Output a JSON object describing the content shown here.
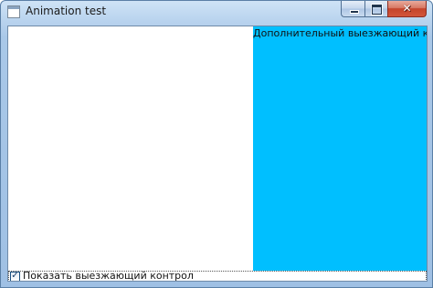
{
  "window": {
    "title": "Animation test"
  },
  "caption_buttons": {
    "minimize_icon": "minimize-icon",
    "maximize_icon": "maximize-icon",
    "close_icon": "close-icon",
    "close_glyph": "✕"
  },
  "slide_panel": {
    "text": "Дополнительный выезжающий контен",
    "background_color": "#00bfff"
  },
  "checkbox": {
    "label": "Показать выезжающий контрол",
    "checked": true,
    "check_glyph": "✓"
  }
}
